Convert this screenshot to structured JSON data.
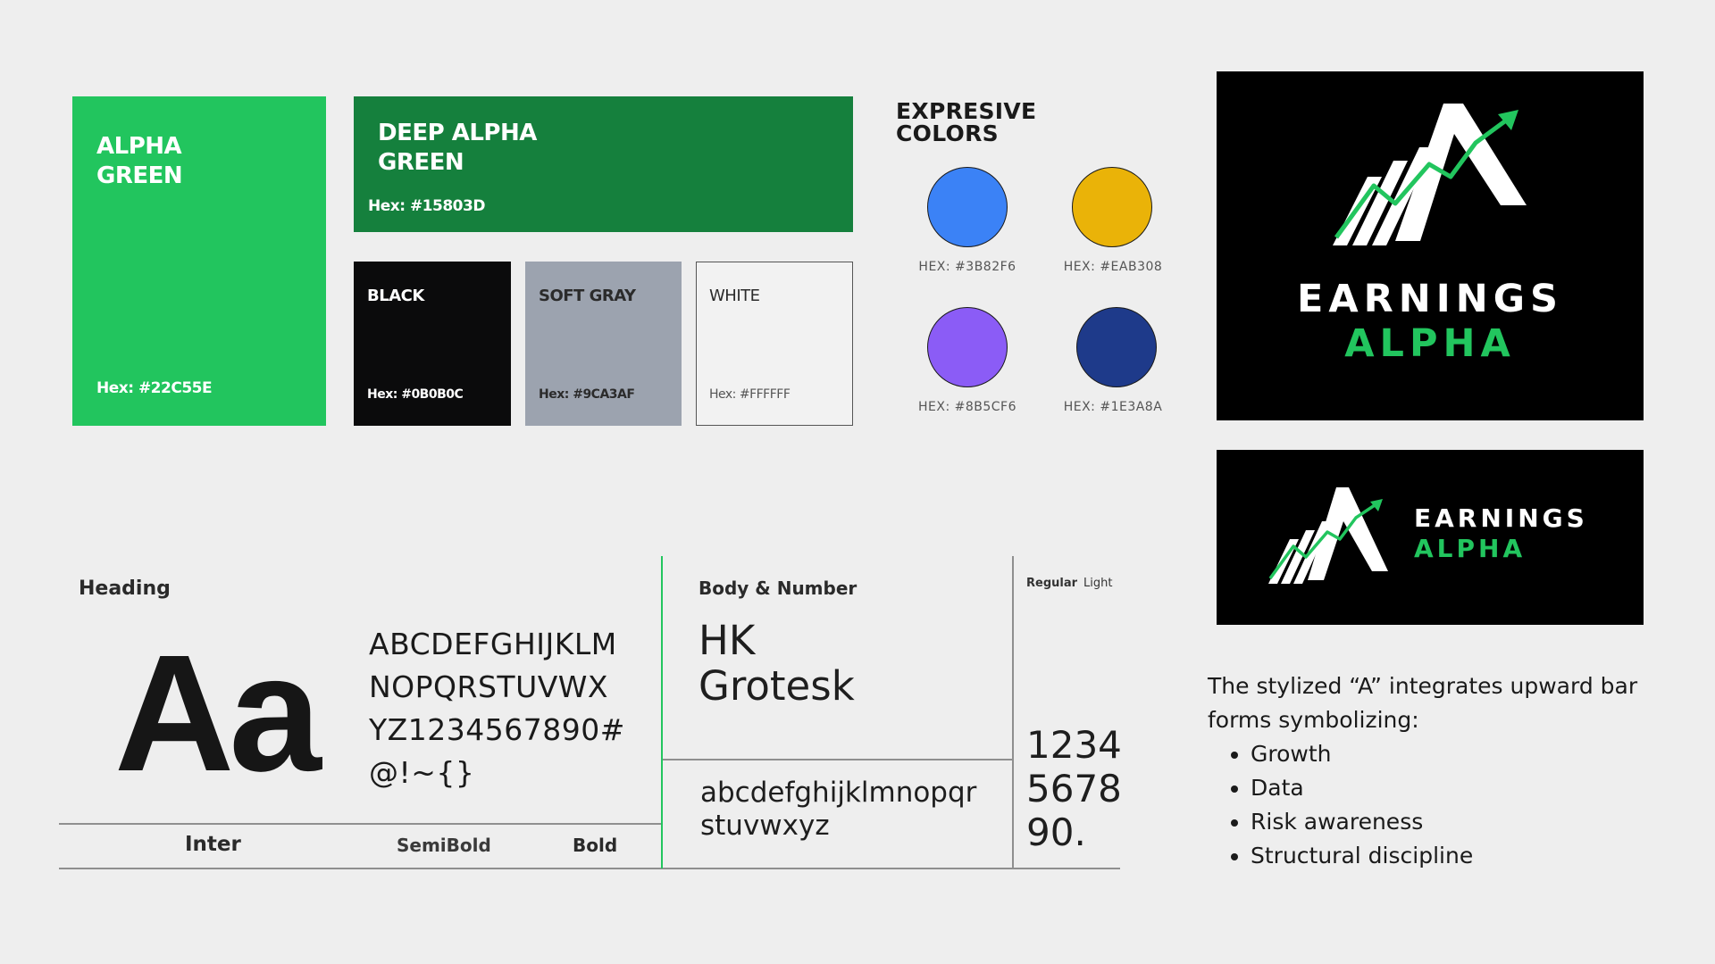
{
  "palette": {
    "alpha_green": {
      "name_line1": "ALPHA",
      "name_line2": "GREEN",
      "hex": "Hex: #22C55E",
      "color": "#22C55E"
    },
    "deep_alpha_green": {
      "name_line1": "DEEP ALPHA",
      "name_line2": "GREEN",
      "hex": "Hex: #15803D",
      "color": "#15803D"
    },
    "black": {
      "name": "BLACK",
      "hex": "Hex: #0B0B0C",
      "color": "#0B0B0C"
    },
    "soft_gray": {
      "name": "SOFT GRAY",
      "hex": "Hex: #9CA3AF",
      "color": "#9CA3AF"
    },
    "white": {
      "name": "WHITE",
      "hex": "Hex: #FFFFFF",
      "color": "#FFFFFF"
    }
  },
  "expressive": {
    "title_line1": "EXPRESIVE",
    "title_line2": "COLORS",
    "colors": [
      {
        "hex": "HEX: #3B82F6",
        "color": "#3B82F6"
      },
      {
        "hex": "HEX: #EAB308",
        "color": "#EAB308"
      },
      {
        "hex": "HEX: #8B5CF6",
        "color": "#8B5CF6"
      },
      {
        "hex": "HEX: #1E3A8A",
        "color": "#1E3A8A"
      }
    ]
  },
  "logo": {
    "word1": "EARNINGS",
    "word2": "ALPHA",
    "word1_color": "#FFFFFF",
    "word2_color": "#22C55E"
  },
  "typography": {
    "heading_label": "Heading",
    "heading_sample": "Aa",
    "heading_glyphs": [
      "ABCDEFGHIJKLM",
      "NOPQRSTUVWX",
      "YZ1234567890#",
      "@!~{}"
    ],
    "heading_font": "Inter",
    "weight_semibold": "SemiBold",
    "weight_bold": "Bold",
    "body_label": "Body & Number",
    "body_font_line1": "HK",
    "body_font_line2": "Grotesk",
    "body_lower_line1": "abcdefghijklmnopqr",
    "body_lower_line2": "stuvwxyz",
    "weight_regular": "Regular",
    "weight_light": "Light",
    "numbers": [
      "1234",
      "5678",
      "90."
    ]
  },
  "description": {
    "text": "The stylized “A” integrates upward bar forms symbolizing:",
    "bullets": [
      "Growth",
      "Data",
      "Risk awareness",
      "Structural discipline"
    ]
  }
}
